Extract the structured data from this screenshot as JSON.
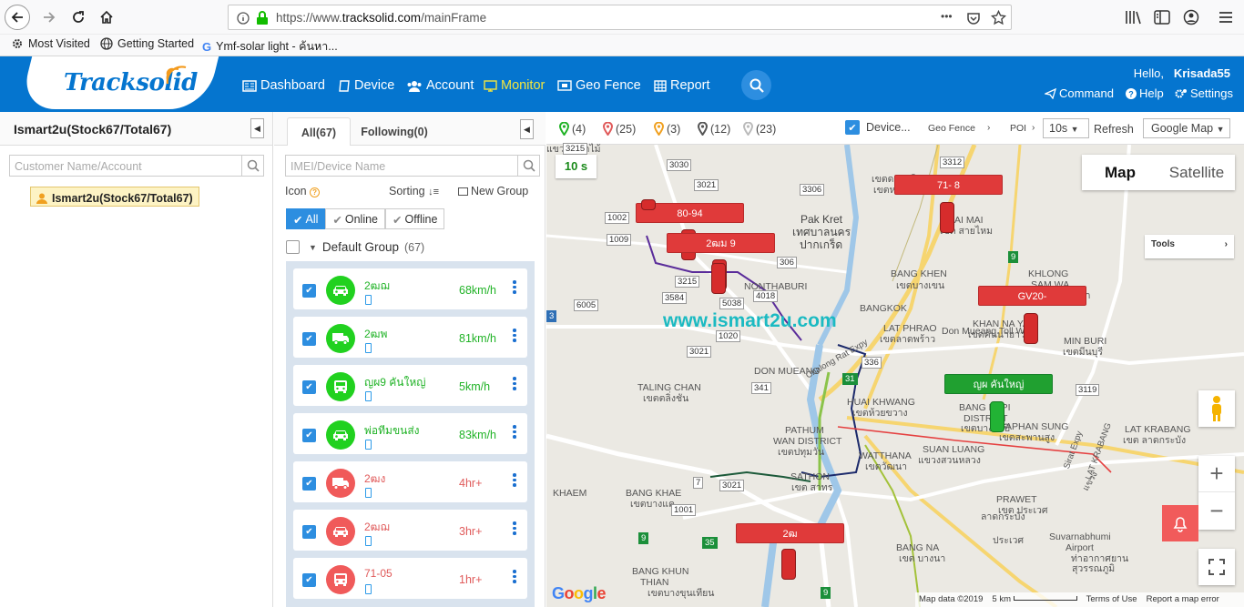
{
  "browser": {
    "url_scheme": "https://www.",
    "url_domain": "tracksolid.com",
    "url_path": "/mainFrame",
    "menu_dots": "•••"
  },
  "bookmarks": [
    {
      "label": "Most Visited"
    },
    {
      "label": "Getting Started"
    },
    {
      "label": "Ymf-solar light - ค้นหา..."
    }
  ],
  "header": {
    "logo": "Tracksolid",
    "menu": [
      {
        "label": "Dashboard"
      },
      {
        "label": "Device"
      },
      {
        "label": "Account"
      },
      {
        "label": "Monitor"
      },
      {
        "label": "Geo Fence"
      },
      {
        "label": "Report"
      }
    ],
    "hello_prefix": "Hello,",
    "user_name": "Krisada55",
    "links": [
      {
        "label": "Command"
      },
      {
        "label": "Help"
      },
      {
        "label": "Settings"
      }
    ]
  },
  "left": {
    "title": "Ismart2u(Stock67/Total67)",
    "search_placeholder": "Customer Name/Account",
    "tree_node": "Ismart2u(Stock67/Total67)"
  },
  "middle": {
    "tabs": [
      {
        "label": "All(67)"
      },
      {
        "label": "Following(0)"
      }
    ],
    "search_placeholder": "IMEI/Device Name",
    "icon_label": "Icon",
    "sorting_label": "Sorting",
    "new_group_label": "New Group",
    "filters": [
      {
        "label": "All"
      },
      {
        "label": "Online"
      },
      {
        "label": "Offline"
      }
    ],
    "group_name": "Default Group",
    "group_count": "(67)",
    "devices": [
      {
        "name": "2ฒฌ",
        "speed": "68km/h",
        "status": "online",
        "vehicle": "car"
      },
      {
        "name": "2ฒพ",
        "speed": "81km/h",
        "status": "online",
        "vehicle": "truck"
      },
      {
        "name": "ญผ9      คันใหญ่",
        "speed": "5km/h",
        "status": "online",
        "vehicle": "bus"
      },
      {
        "name": "พ่อทีมขนส่ง",
        "speed": "83km/h",
        "status": "online",
        "vehicle": "car"
      },
      {
        "name": "2ฒง",
        "speed": "4hr+",
        "status": "offline",
        "vehicle": "truck"
      },
      {
        "name": "2ฒฌ",
        "speed": "3hr+",
        "status": "offline",
        "vehicle": "car"
      },
      {
        "name": "71-05",
        "speed": "1hr+",
        "status": "offline",
        "vehicle": "bus"
      }
    ]
  },
  "map_toolbar": {
    "pins": [
      {
        "count": "(4)",
        "color": "#22b327"
      },
      {
        "count": "(25)",
        "color": "#e05a5a"
      },
      {
        "count": "(3)",
        "color": "#f0a020"
      },
      {
        "count": "(12)",
        "color": "#555555"
      },
      {
        "count": "(23)",
        "color": "#bbbbbb"
      }
    ],
    "device_label": "Device...",
    "geofence_label": "Geo Fence",
    "poi_label": "POI",
    "interval": "10s",
    "refresh_label": "Refresh",
    "map_provider": "Google Map"
  },
  "map": {
    "countdown": "10 s",
    "type_map": "Map",
    "type_satellite": "Satellite",
    "tools_label": "Tools",
    "watermark": "www.ismart2u.com",
    "google": "Google",
    "footer": {
      "data": "Map data ©2019",
      "scale": "5 km",
      "terms": "Terms of Use",
      "report": "Report a map error"
    },
    "places": [
      {
        "text": "Pak Kret",
        "big": true
      },
      {
        "text": "เทศบาลนคร",
        "big": true
      },
      {
        "text": "ปากเกร็ด",
        "big": true
      },
      {
        "text": "BANG KHEN"
      },
      {
        "text": "เขตบางเขน"
      },
      {
        "text": "SAI MAI"
      },
      {
        "text": "เขต สายไหม"
      },
      {
        "text": "KHLONG"
      },
      {
        "text": "SAM WA"
      },
      {
        "text": "เขตคลองสามวา"
      },
      {
        "text": "LAT PHRAO"
      },
      {
        "text": "เขตลาดพร้าว"
      },
      {
        "text": "KHAN NA YAO"
      },
      {
        "text": "เขตคันนายาว"
      },
      {
        "text": "MIN BURI"
      },
      {
        "text": "เขตมีนบุรี"
      },
      {
        "text": "NONTHABURI"
      },
      {
        "text": "TALING CHAN"
      },
      {
        "text": "เขตตลิ่งชัน"
      },
      {
        "text": "HUAI KHWANG"
      },
      {
        "text": "เขตห้วยขวาง"
      },
      {
        "text": "BANG KAPI"
      },
      {
        "text": "DISTRICT"
      },
      {
        "text": "เขตบางกะปิ"
      },
      {
        "text": "SAPHAN SUNG"
      },
      {
        "text": "เขตสะพานสูง"
      },
      {
        "text": "LAT KRABANG"
      },
      {
        "text": "เขต ลาดกระบัง"
      },
      {
        "text": "PATHUM"
      },
      {
        "text": "WAN DISTRICT"
      },
      {
        "text": "เขตปทุมวัน"
      },
      {
        "text": "WATTHANA"
      },
      {
        "text": "เขตวัฒนา"
      },
      {
        "text": "SUAN LUANG"
      },
      {
        "text": "แขวงสวนหลวง"
      },
      {
        "text": "BANG KHAE"
      },
      {
        "text": "เขตบางแค"
      },
      {
        "text": "SATHON"
      },
      {
        "text": "เขต สาทร"
      },
      {
        "text": "PRAWET"
      },
      {
        "text": "เขต ประเวศ"
      },
      {
        "text": "Suvarnabhumi"
      },
      {
        "text": "Airport"
      },
      {
        "text": "ท่าอากาศยาน"
      },
      {
        "text": "สุวรรณภูมิ"
      },
      {
        "text": "BANG NA"
      },
      {
        "text": "เขต บางนา"
      },
      {
        "text": "BANG KHUN"
      },
      {
        "text": "THIAN"
      },
      {
        "text": "เขตบางขุนเทียน"
      },
      {
        "text": "KHAEM"
      },
      {
        "text": "เขตหนองแขม"
      },
      {
        "text": "เขตดอนเมือง"
      },
      {
        "text": "DON MUEANG"
      },
      {
        "text": "BANGKOK"
      },
      {
        "text": "Don Mueang Toll Way"
      },
      {
        "text": "Chalong Rat Expy"
      },
      {
        "text": "Sirat Expy"
      },
      {
        "text": "LAT KRABANG"
      },
      {
        "text": "แขวง"
      },
      {
        "text": "ลาดกระบัง"
      },
      {
        "text": "ประเวศ"
      },
      {
        "text": "แขวง ดอกไม้"
      }
    ],
    "road_numbers": [
      "3215",
      "3030",
      "3021",
      "1002",
      "1009",
      "3215",
      "3584",
      "5038",
      "4018",
      "306",
      "3312",
      "3306",
      "9",
      "6005",
      "1020",
      "3021",
      "336",
      "31",
      "341",
      "3119",
      "3021",
      "1001",
      "35",
      "9",
      "9",
      "7",
      "3"
    ],
    "vehicles": [
      {
        "label": "80-94",
        "color": "red"
      },
      {
        "label": "2ฒม  9",
        "color": "red"
      },
      {
        "label": "71-  8",
        "color": "red"
      },
      {
        "label": "GV20-",
        "color": "red"
      },
      {
        "label": "ญผ     คันใหญ่",
        "color": "green"
      },
      {
        "label": "2ฒ",
        "color": "red"
      }
    ]
  }
}
